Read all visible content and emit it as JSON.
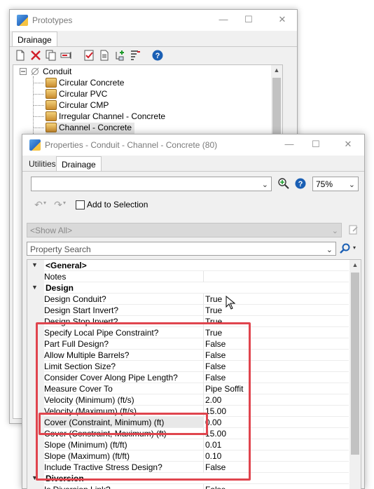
{
  "prototypes_window": {
    "title": "Prototypes",
    "minimize_glyph": "—",
    "maximize_glyph": "☐",
    "close_glyph": "✕",
    "tab": "Drainage",
    "toolbar_icons": [
      "new-icon",
      "delete-icon",
      "copy-icon",
      "rename-icon",
      "validate-icon",
      "report-icon",
      "add-child-icon",
      "sort-icon",
      "help-icon"
    ],
    "tree": {
      "root_label": "Conduit",
      "items": [
        "Circular Concrete",
        "Circular PVC",
        "Circular CMP",
        "Irregular Channel - Concrete",
        "Channel - Concrete"
      ],
      "selected_index": 4
    }
  },
  "properties_window": {
    "title": "Properties - Conduit - Channel - Concrete (80)",
    "minimize_glyph": "—",
    "maximize_glyph": "☐",
    "close_glyph": "✕",
    "tabs": [
      "Utilities",
      "Drainage"
    ],
    "active_tab": "Drainage",
    "element_combo_value": "",
    "zoom_value": "75%",
    "add_to_selection_label": "Add to Selection",
    "filter_combo_value": "<Show All>",
    "search_placeholder": "Property Search",
    "categories": {
      "general": "<General>",
      "design": "Design",
      "diversion": "Diversion"
    },
    "general_rows": [
      {
        "name": "Notes",
        "value": ""
      }
    ],
    "design_rows": [
      {
        "name": "Design Conduit?",
        "value": "True"
      },
      {
        "name": "Design Start Invert?",
        "value": "True"
      },
      {
        "name": "Design Stop Invert?",
        "value": "True"
      },
      {
        "name": "Specify Local Pipe Constraint?",
        "value": "True"
      },
      {
        "name": "Part Full Design?",
        "value": "False"
      },
      {
        "name": "Allow Multiple Barrels?",
        "value": "False"
      },
      {
        "name": "Limit Section Size?",
        "value": "False"
      },
      {
        "name": "Consider Cover Along Pipe Length?",
        "value": "False"
      },
      {
        "name": "Measure Cover To",
        "value": "Pipe Soffit"
      },
      {
        "name": "Velocity (Minimum) (ft/s)",
        "value": "2.00"
      },
      {
        "name": "Velocity (Maximum) (ft/s)",
        "value": "15.00"
      },
      {
        "name": "Cover (Constraint, Minimum) (ft)",
        "value": "0.00"
      },
      {
        "name": "Cover (Constraint, Maximum) (ft)",
        "value": "15.00"
      },
      {
        "name": "Slope (Minimum) (ft/ft)",
        "value": "0.01"
      },
      {
        "name": "Slope (Maximum) (ft/ft)",
        "value": "0.10"
      },
      {
        "name": "Include Tractive Stress Design?",
        "value": "False"
      }
    ],
    "diversion_rows": [
      {
        "name": "Is Diversion Link?",
        "value": "False"
      }
    ]
  },
  "colors": {
    "highlight_box": "#e0454e",
    "help_blue": "#1a5fb4"
  }
}
